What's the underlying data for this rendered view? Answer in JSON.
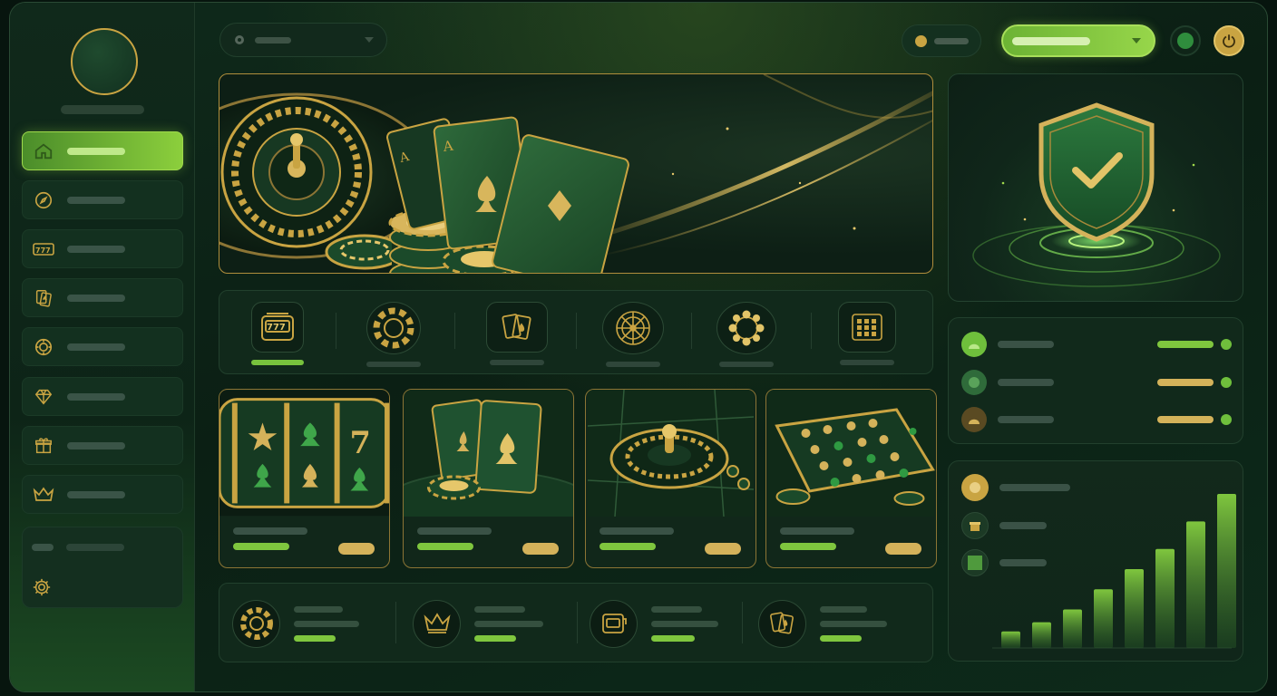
{
  "app": {
    "colors": {
      "accent_green": "#8ccf3c",
      "gold": "#c9a442",
      "panel": "#11291b",
      "background": "#0b1f14"
    }
  },
  "sidebar": {
    "items": [
      {
        "icon": "home-icon",
        "active": true
      },
      {
        "icon": "compass-icon",
        "active": false
      },
      {
        "icon": "slot-777-icon",
        "active": false
      },
      {
        "icon": "playing-cards-icon",
        "active": false
      },
      {
        "icon": "poker-chip-icon",
        "active": false
      },
      {
        "icon": "diamond-icon",
        "active": false
      },
      {
        "icon": "gift-icon",
        "active": false
      },
      {
        "icon": "crown-icon",
        "active": false
      }
    ],
    "footer": {
      "icon": "gear-icon"
    }
  },
  "header": {
    "search_select": {
      "icon": "radio-dot-icon"
    },
    "balance_pill": {
      "icon": "coin-icon"
    },
    "deposit_button": {
      "icon": "chevron-down-icon"
    },
    "notification_icon": "status-dot-icon",
    "profile_icon": "power-icon"
  },
  "hero": {
    "art": "roulette-cards-chips-banner"
  },
  "security_card": {
    "icon": "shield-check-icon"
  },
  "categories": [
    {
      "icon": "slot-777-icon",
      "active": true
    },
    {
      "icon": "poker-chip-icon",
      "active": false
    },
    {
      "icon": "playing-cards-icon",
      "active": false
    },
    {
      "icon": "roulette-wheel-icon",
      "active": false
    },
    {
      "icon": "chip-ring-icon",
      "active": false
    },
    {
      "icon": "bingo-grid-icon",
      "active": false
    }
  ],
  "games": [
    {
      "art": "slot-reels"
    },
    {
      "art": "blackjack-cards"
    },
    {
      "art": "roulette-table"
    },
    {
      "art": "bingo-board"
    }
  ],
  "promos": [
    {
      "icon": "poker-chip-icon"
    },
    {
      "icon": "crown-icon"
    },
    {
      "icon": "slot-machine-icon"
    },
    {
      "icon": "playing-cards-icon"
    }
  ],
  "leaderboard": [
    {
      "progress": 1.0,
      "color": "#7fc63e"
    },
    {
      "progress": 1.0,
      "color": "#d4b25a"
    },
    {
      "progress": 1.0,
      "color": "#d4b25a"
    }
  ],
  "stats": {
    "chart_data": {
      "type": "bar",
      "values": [
        18,
        28,
        42,
        64,
        86,
        108,
        138,
        168
      ]
    }
  }
}
